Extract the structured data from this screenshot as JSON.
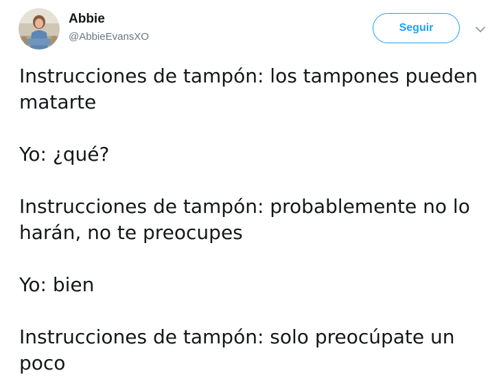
{
  "user": {
    "name": "Abbie",
    "handle": "@AbbieEvansXO",
    "avatar_icon": "profile-photo"
  },
  "actions": {
    "follow_label": "Seguir",
    "more_icon": "chevron-down-icon"
  },
  "tweet": {
    "paragraphs": [
      "Instrucciones de tampón: los tampones pueden matarte",
      "Yo: ¿qué?",
      "Instrucciones de tampón: probablemente no lo harán, no te preocupes",
      "Yo: bien",
      "Instrucciones de tampón: solo preocúpate un poco"
    ]
  },
  "colors": {
    "accent": "#1da1f2",
    "text": "#14171a",
    "muted": "#657786"
  }
}
